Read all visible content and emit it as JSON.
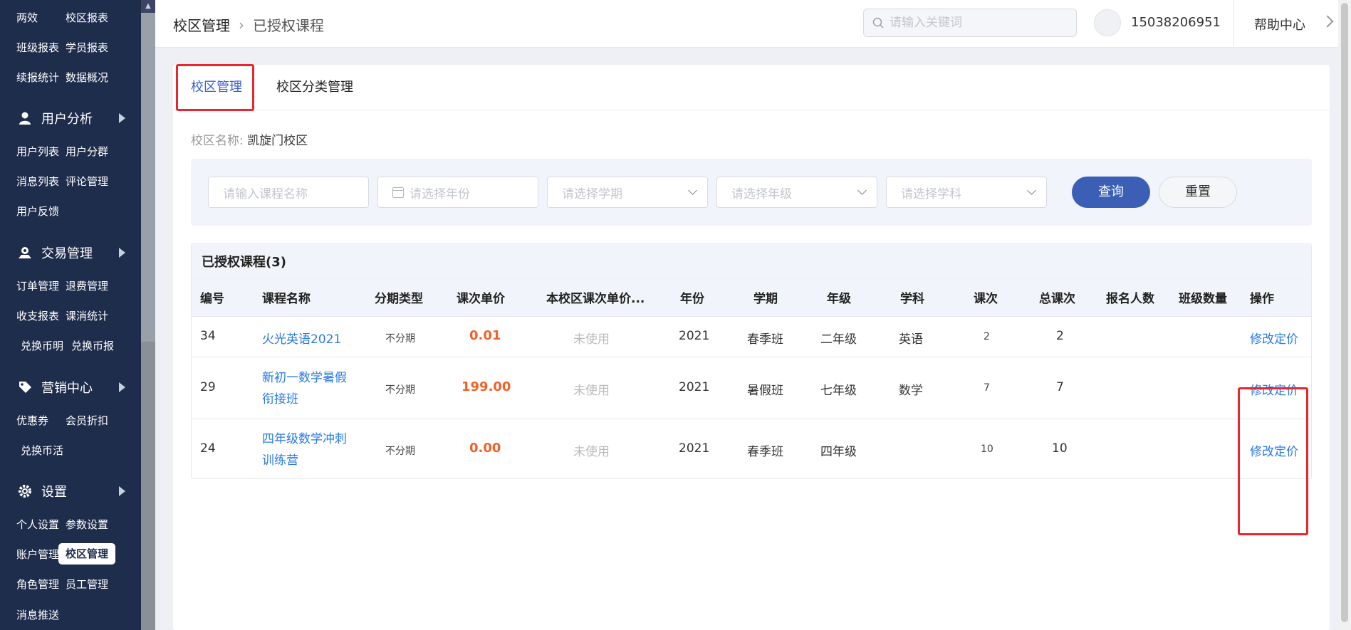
{
  "sidebar": {
    "rows_top": [
      [
        "两效",
        "校区报表"
      ],
      [
        "班级报表",
        "学员报表"
      ],
      [
        "续报统计",
        "数据概况"
      ]
    ],
    "group_user": "用户分析",
    "rows_user": [
      [
        "用户列表",
        "用户分群"
      ],
      [
        "消息列表",
        "评论管理"
      ],
      [
        "用户反馈",
        ""
      ]
    ],
    "group_trade": "交易管理",
    "rows_trade": [
      [
        "订单管理",
        "退费管理"
      ],
      [
        "收支报表",
        "课消统计"
      ],
      [
        "兑换币明",
        "兑换币报"
      ]
    ],
    "group_market": "营销中心",
    "rows_market": [
      [
        "优惠券",
        "会员折扣"
      ],
      [
        "兑换币活",
        ""
      ]
    ],
    "group_settings": "设置",
    "rows_settings": [
      [
        "个人设置",
        "参数设置"
      ],
      [
        "账户管理",
        "校区管理"
      ],
      [
        "角色管理",
        "员工管理"
      ],
      [
        "消息推送",
        ""
      ]
    ],
    "active_item": "校区管理"
  },
  "header": {
    "breadcrumb_root": "校区管理",
    "breadcrumb_current": "已授权课程",
    "search_placeholder": "请输入关键词",
    "phone": "15038206951",
    "help": "帮助中心"
  },
  "tabs": [
    {
      "label": "校区管理",
      "active": true
    },
    {
      "label": "校区分类管理",
      "active": false
    }
  ],
  "campus": {
    "label": "校区名称:",
    "value": "凯旋门校区"
  },
  "filters": {
    "course_name_placeholder": "请输入课程名称",
    "year_placeholder": "请选择年份",
    "term_placeholder": "请选择学期",
    "grade_placeholder": "请选择年级",
    "subject_placeholder": "请选择学科",
    "query_label": "查询",
    "reset_label": "重置"
  },
  "table": {
    "title": "已授权课程(3)",
    "columns": [
      "编号",
      "课程名称",
      "分期类型",
      "课次单价",
      "本校区课次单价...",
      "年份",
      "学期",
      "年级",
      "学科",
      "课次",
      "总课次",
      "报名人数",
      "班级数量",
      "操作"
    ],
    "rows": [
      {
        "id": "34",
        "name_line1": "火光英语2021",
        "name_line2": "",
        "installment": "不分期",
        "price": "0.01",
        "campus_price": "未使用",
        "year": "2021",
        "term": "春季班",
        "grade": "二年级",
        "subject": "英语",
        "lessons": "2",
        "total": "2",
        "enrolled": "",
        "classes": "",
        "action": "修改定价"
      },
      {
        "id": "29",
        "name_line1": "新初一数学暑假",
        "name_line2": "衔接班",
        "installment": "不分期",
        "price": "199.00",
        "campus_price": "未使用",
        "year": "2021",
        "term": "暑假班",
        "grade": "七年级",
        "subject": "数学",
        "lessons": "7",
        "total": "7",
        "enrolled": "",
        "classes": "",
        "action": "修改定价"
      },
      {
        "id": "24",
        "name_line1": "四年级数学冲刺",
        "name_line2": "训练营",
        "installment": "不分期",
        "price": "0.00",
        "campus_price": "未使用",
        "year": "2021",
        "term": "春季班",
        "grade": "四年级",
        "subject": "",
        "lessons": "10",
        "total": "10",
        "enrolled": "",
        "classes": "",
        "action": "修改定价"
      }
    ]
  },
  "colors": {
    "sidebar_bg": "#1f2d4d",
    "accent": "#3a5fb4",
    "price": "#f0622a",
    "link": "#2a7ae2",
    "highlight": "#e8262d"
  }
}
